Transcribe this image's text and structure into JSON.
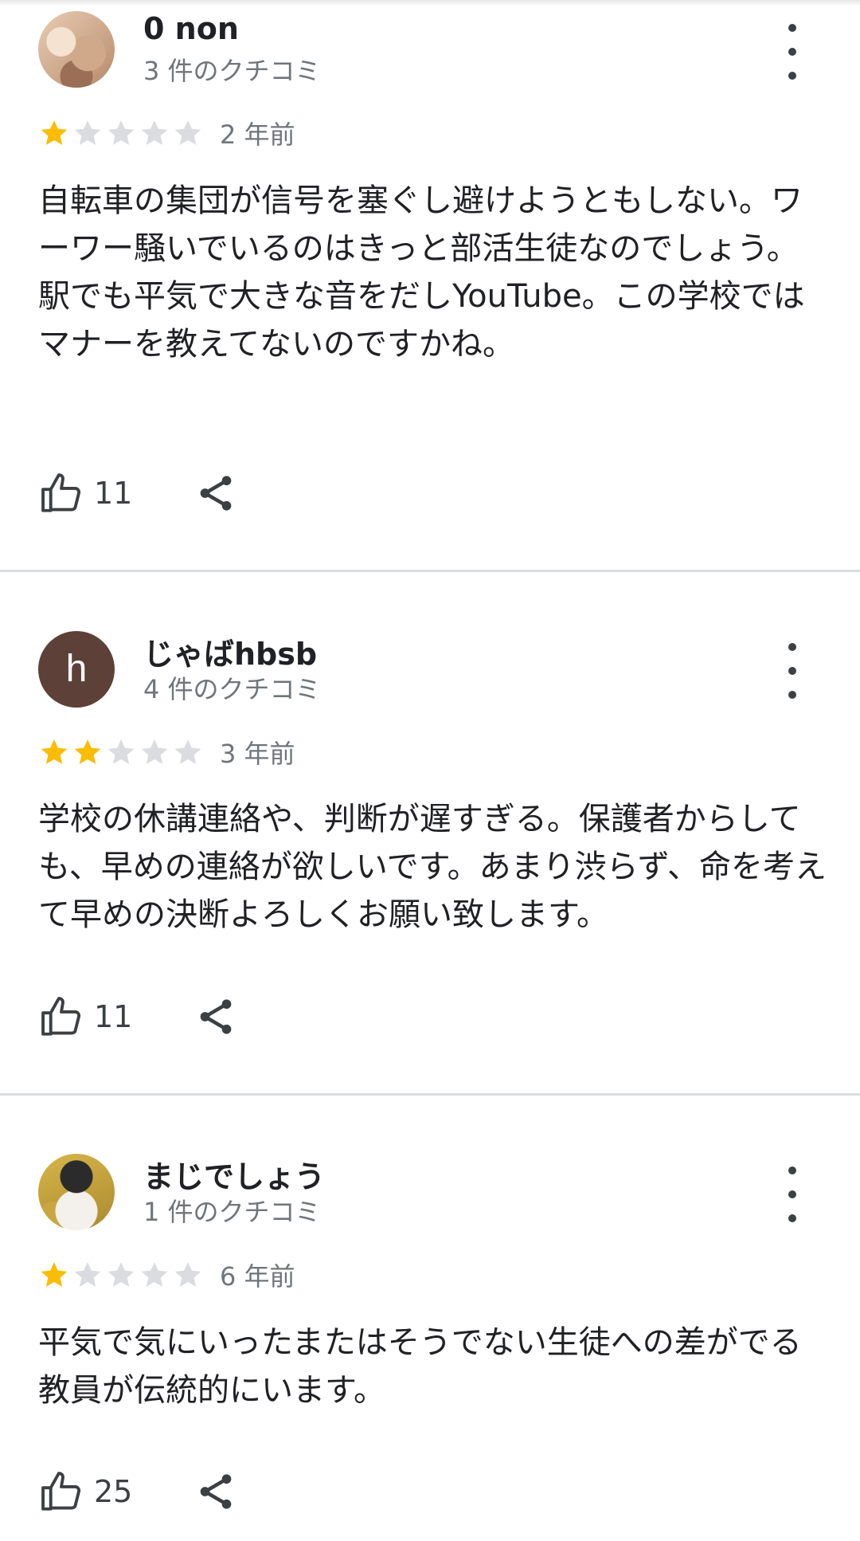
{
  "reviews": [
    {
      "name": "0 non",
      "review_count": "3 件のクチコミ",
      "rating": 1,
      "age": "2 年前",
      "text": "自転車の集団が信号を塞ぐし避けようともしない。ワーワー騒いでいるのはきっと部活生徒なのでしょう。\n駅でも平気で大きな音をだしYouTube。この学校ではマナーを教えてないのですかね。",
      "likes": "11",
      "avatar_letter": ""
    },
    {
      "name": "じゃばhbsb",
      "review_count": "4 件のクチコミ",
      "rating": 2,
      "age": "3 年前",
      "text": "学校の休講連絡や、判断が遅すぎる。保護者からしても、早めの連絡が欲しいです。あまり渋らず、命を考えて早めの決断よろしくお願い致します。",
      "likes": "11",
      "avatar_letter": "h"
    },
    {
      "name": "まじでしょう",
      "review_count": "1 件のクチコミ",
      "rating": 1,
      "age": "6 年前",
      "text": "平気で気にいったまたはそうでない生徒への差がでる教員が伝統的にいます。",
      "likes": "25",
      "avatar_letter": ""
    }
  ],
  "colors": {
    "star_filled": "#FBBC04",
    "star_empty": "#DADCE0",
    "avatar_letter_bg": "#5D4037",
    "divider": "#DADCE0"
  }
}
